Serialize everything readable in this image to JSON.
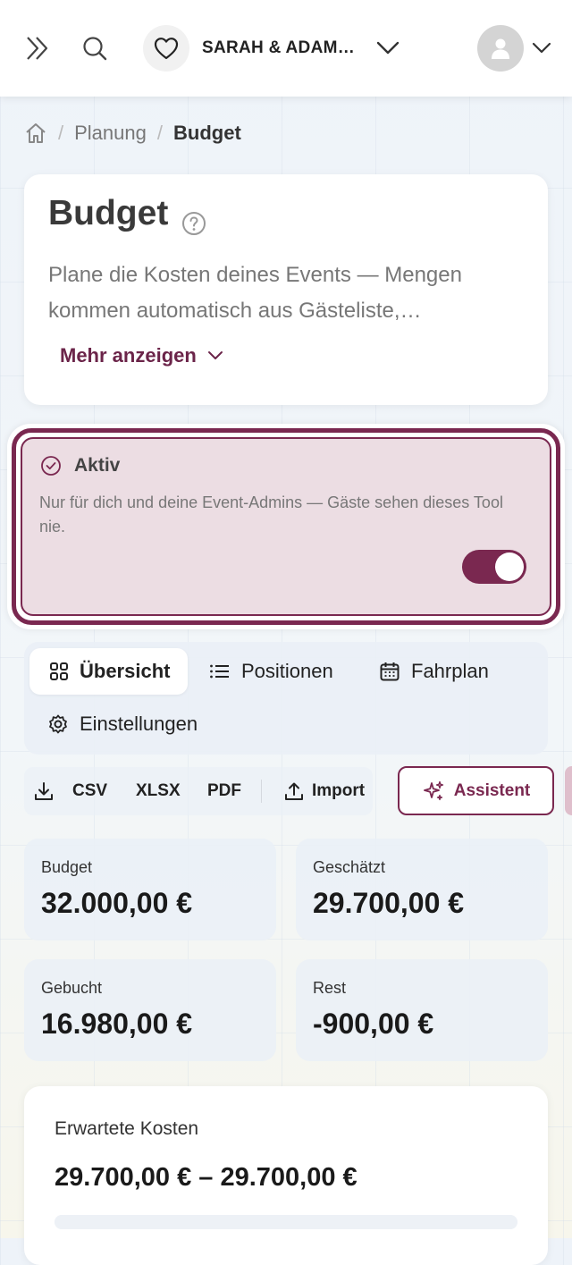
{
  "header": {
    "event_name": "SARAH & ADAM…",
    "icons": [
      "expand-icon",
      "search-icon",
      "heart-icon",
      "chevron-down-icon",
      "user-icon"
    ]
  },
  "breadcrumb": {
    "items": [
      "Planung",
      "Budget"
    ]
  },
  "intro": {
    "title": "Budget",
    "description": "Plane die Kosten deines Events — Mengen kommen automatisch aus Gästeliste,…",
    "more_label": "Mehr anzeigen"
  },
  "status": {
    "title": "Aktiv",
    "description": "Nur für dich und deine Event-Admins — Gäste sehen dieses Tool nie.",
    "enabled": true
  },
  "tabs": [
    {
      "label": "Übersicht",
      "selected": true
    },
    {
      "label": "Positionen",
      "selected": false
    },
    {
      "label": "Fahrplan",
      "selected": false
    },
    {
      "label": "Einstellungen",
      "selected": false
    }
  ],
  "toolbar": {
    "csv": "CSV",
    "xlsx": "XLSX",
    "pdf": "PDF",
    "import": "Import",
    "assistant": "Assistent"
  },
  "stats": [
    {
      "label": "Budget",
      "value": "32.000,00 €"
    },
    {
      "label": "Geschätzt",
      "value": "29.700,00 €"
    },
    {
      "label": "Gebucht",
      "value": "16.980,00 €"
    },
    {
      "label": "Rest",
      "value": "-900,00 €"
    }
  ],
  "expected": {
    "label": "Erwartete Kosten",
    "value": "29.700,00 € – 29.700,00 €"
  },
  "colors": {
    "accent": "#7a2850",
    "active_bg": "#ecdde3"
  }
}
